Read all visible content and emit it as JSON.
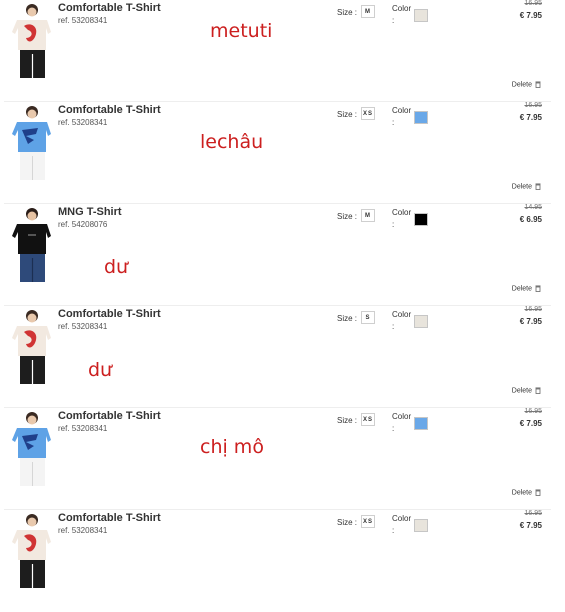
{
  "labels": {
    "size": "Size :",
    "color": "Color",
    "color_colon": ":",
    "delete": "Delete"
  },
  "items": [
    {
      "name": "Comfortable T-Shirt",
      "ref": "ref. 53208341",
      "size": "M",
      "color_hex": "#e8e4dc",
      "old_price": "16.95",
      "new_price": "€ 7.95",
      "note": "metuti",
      "shirt": "cream"
    },
    {
      "name": "Comfortable T-Shirt",
      "ref": "ref. 53208341",
      "size": "XS",
      "color_hex": "#6aa8e8",
      "old_price": "16.95",
      "new_price": "€ 7.95",
      "note": "lechâu",
      "shirt": "blue"
    },
    {
      "name": "MNG T-Shirt",
      "ref": "ref. 54208076",
      "size": "M",
      "color_hex": "#000000",
      "old_price": "14.95",
      "new_price": "€ 6.95",
      "note": "dư",
      "shirt": "black"
    },
    {
      "name": "Comfortable T-Shirt",
      "ref": "ref. 53208341",
      "size": "S",
      "color_hex": "#e8e4dc",
      "old_price": "16.95",
      "new_price": "€ 7.95",
      "note": "dư",
      "shirt": "cream"
    },
    {
      "name": "Comfortable T-Shirt",
      "ref": "ref. 53208341",
      "size": "XS",
      "color_hex": "#6aa8e8",
      "old_price": "16.95",
      "new_price": "€ 7.95",
      "note": "chị mô",
      "shirt": "blue"
    },
    {
      "name": "Comfortable T-Shirt",
      "ref": "ref. 53208341",
      "size": "XS",
      "color_hex": "#e8e4dc",
      "old_price": "16.95",
      "new_price": "€ 7.95",
      "note": "",
      "shirt": "cream"
    }
  ]
}
